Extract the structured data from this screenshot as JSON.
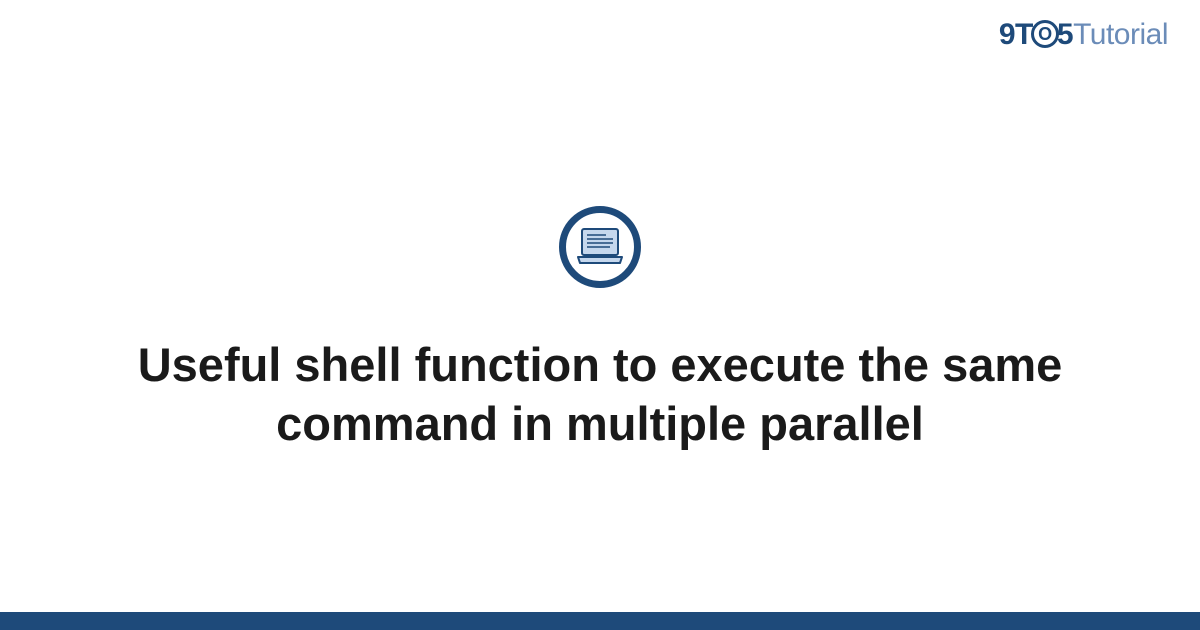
{
  "brand": {
    "part1": "9T",
    "circle": "O",
    "part2": "5",
    "part3": "Tutorial"
  },
  "icon": {
    "name": "laptop-icon"
  },
  "title": "Useful shell function to execute the same command in multiple parallel",
  "colors": {
    "primary": "#1e4a7a",
    "secondary": "#6b8cb8",
    "iconFill": "#c5d7ed"
  }
}
